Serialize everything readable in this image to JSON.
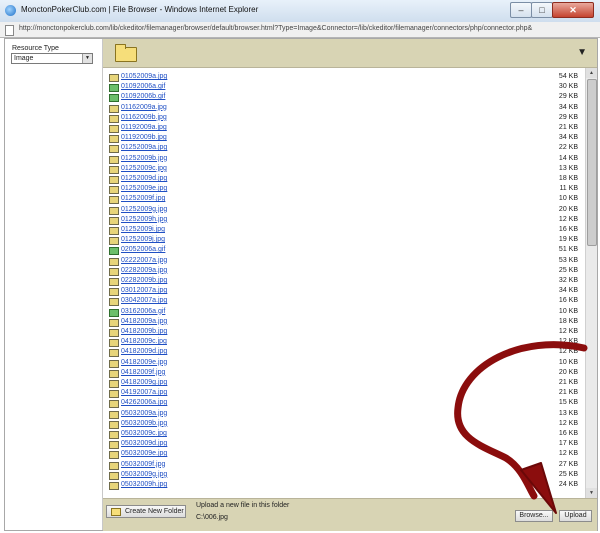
{
  "window": {
    "title": "MonctonPokerClub.com | File Browser - Windows Internet Explorer",
    "url": "http://monctonpokerclub.com/lib/ckeditor/filemanager/browser/default/browser.html?Type=Image&Connector=/lib/ckeditor/filemanager/connectors/php/connector.php&",
    "minimize_glyph": "–",
    "maximize_glyph": "□",
    "close_glyph": "✕"
  },
  "sidebar": {
    "resource_type_label": "Resource Type",
    "resource_type_value": "Image"
  },
  "folderbar": {
    "dropdown_glyph": "▼"
  },
  "files": [
    {
      "name": "01052009a.jpg",
      "size": "54 KB",
      "icon": "image-file-icon"
    },
    {
      "name": "01092006a.gif",
      "size": "30 KB",
      "icon": "gif-file-icon"
    },
    {
      "name": "01092006b.gif",
      "size": "29 KB",
      "icon": "gif-file-icon"
    },
    {
      "name": "01162009a.jpg",
      "size": "34 KB",
      "icon": "image-file-icon"
    },
    {
      "name": "01162009b.jpg",
      "size": "29 KB",
      "icon": "image-file-icon"
    },
    {
      "name": "01192009a.jpg",
      "size": "21 KB",
      "icon": "image-file-icon"
    },
    {
      "name": "01192009b.jpg",
      "size": "34 KB",
      "icon": "image-file-icon"
    },
    {
      "name": "01252009a.jpg",
      "size": "22 KB",
      "icon": "image-file-icon"
    },
    {
      "name": "01252009b.jpg",
      "size": "14 KB",
      "icon": "image-file-icon"
    },
    {
      "name": "01252009c.jpg",
      "size": "13 KB",
      "icon": "image-file-icon"
    },
    {
      "name": "01252009d.jpg",
      "size": "18 KB",
      "icon": "image-file-icon"
    },
    {
      "name": "01252009e.jpg",
      "size": "11 KB",
      "icon": "image-file-icon"
    },
    {
      "name": "01252009f.jpg",
      "size": "10 KB",
      "icon": "image-file-icon"
    },
    {
      "name": "01252009g.jpg",
      "size": "20 KB",
      "icon": "image-file-icon"
    },
    {
      "name": "01252009h.jpg",
      "size": "12 KB",
      "icon": "image-file-icon"
    },
    {
      "name": "01252009i.jpg",
      "size": "16 KB",
      "icon": "image-file-icon"
    },
    {
      "name": "01252009j.jpg",
      "size": "19 KB",
      "icon": "image-file-icon"
    },
    {
      "name": "02052006a.gif",
      "size": "51 KB",
      "icon": "gif-file-icon"
    },
    {
      "name": "02222007a.jpg",
      "size": "53 KB",
      "icon": "image-file-icon"
    },
    {
      "name": "02282009a.jpg",
      "size": "25 KB",
      "icon": "image-file-icon"
    },
    {
      "name": "02282009b.jpg",
      "size": "32 KB",
      "icon": "image-file-icon"
    },
    {
      "name": "03012007a.jpg",
      "size": "34 KB",
      "icon": "image-file-icon"
    },
    {
      "name": "03042007a.jpg",
      "size": "16 KB",
      "icon": "image-file-icon"
    },
    {
      "name": "03162006a.gif",
      "size": "10 KB",
      "icon": "gif-file-icon"
    },
    {
      "name": "04182009a.jpg",
      "size": "18 KB",
      "icon": "image-file-icon"
    },
    {
      "name": "04182009b.jpg",
      "size": "12 KB",
      "icon": "image-file-icon"
    },
    {
      "name": "04182009c.jpg",
      "size": "12 KB",
      "icon": "image-file-icon"
    },
    {
      "name": "04182009d.jpg",
      "size": "12 KB",
      "icon": "image-file-icon"
    },
    {
      "name": "04182009e.jpg",
      "size": "10 KB",
      "icon": "image-file-icon"
    },
    {
      "name": "04182009f.jpg",
      "size": "20 KB",
      "icon": "image-file-icon"
    },
    {
      "name": "04182009g.jpg",
      "size": "21 KB",
      "icon": "image-file-icon"
    },
    {
      "name": "04192007a.jpg",
      "size": "21 KB",
      "icon": "image-file-icon"
    },
    {
      "name": "04262006a.jpg",
      "size": "15 KB",
      "icon": "image-file-icon"
    },
    {
      "name": "05032009a.jpg",
      "size": "13 KB",
      "icon": "image-file-icon"
    },
    {
      "name": "05032009b.jpg",
      "size": "12 KB",
      "icon": "image-file-icon"
    },
    {
      "name": "05032009c.jpg",
      "size": "16 KB",
      "icon": "image-file-icon"
    },
    {
      "name": "05032009d.jpg",
      "size": "17 KB",
      "icon": "image-file-icon"
    },
    {
      "name": "05032009e.jpg",
      "size": "12 KB",
      "icon": "image-file-icon"
    },
    {
      "name": "05032009f.jpg",
      "size": "27 KB",
      "icon": "image-file-icon"
    },
    {
      "name": "05032009g.jpg",
      "size": "25 KB",
      "icon": "image-file-icon"
    },
    {
      "name": "05032009h.jpg",
      "size": "24 KB",
      "icon": "image-file-icon"
    }
  ],
  "bottombar": {
    "new_folder_label": "Create New Folder",
    "upload_label": "Upload a new file in this folder",
    "upload_path": "C:\\006.jpg",
    "browse_label": "Browse...",
    "upload_button_label": "Upload"
  },
  "colors": {
    "toolbar_bg": "#d8d4b4",
    "link": "#1f4fc4",
    "annotation_arrow": "#8b0d0d"
  }
}
